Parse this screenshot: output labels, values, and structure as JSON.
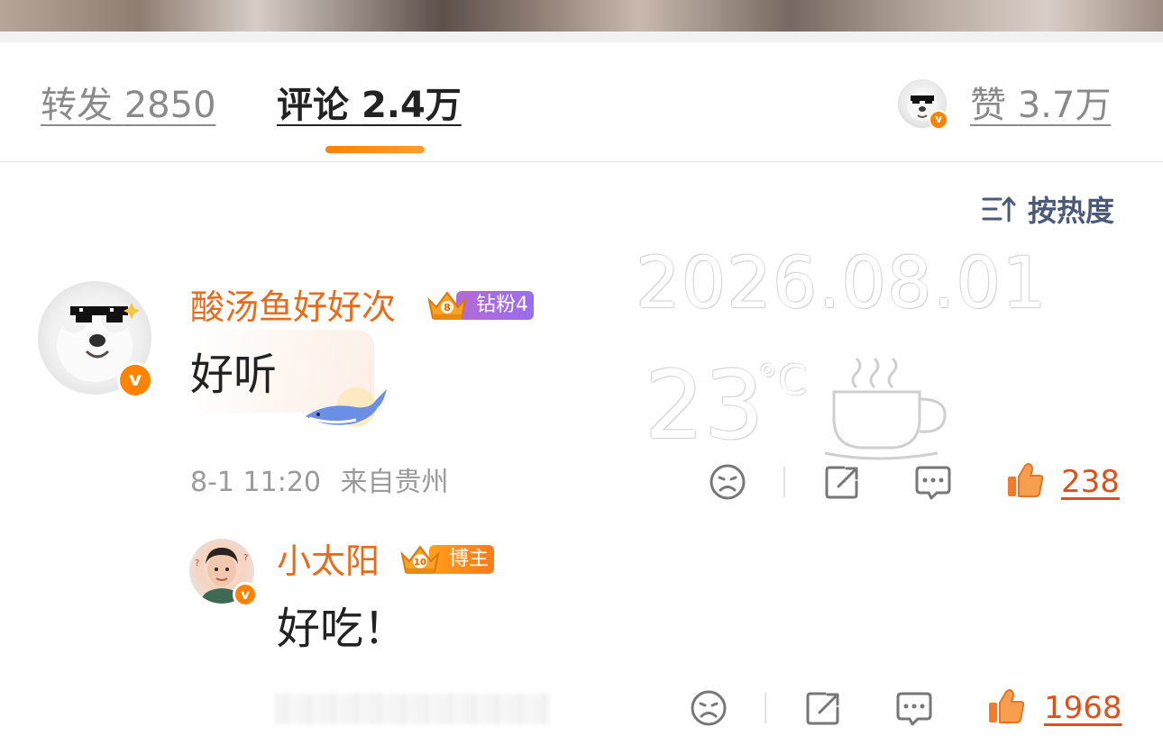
{
  "tabs": {
    "repost": {
      "label": "转发",
      "count": "2850"
    },
    "comments": {
      "label": "评论",
      "count": "2.4万"
    },
    "likes": {
      "label": "赞",
      "count": "3.7万"
    }
  },
  "sort": {
    "label": "按热度"
  },
  "watermark": {
    "date": "2026.08.01",
    "temperature": "23",
    "unit": "°C"
  },
  "colors": {
    "accent": "#ff8200",
    "username": "#e86b1a",
    "like": "#d9531e",
    "sort": "#4a5a78"
  },
  "comments": [
    {
      "username": "酸汤鱼好好次",
      "badge": {
        "level": "8",
        "label": "钻粉4"
      },
      "text": "好听",
      "time": "8-1 11:20",
      "location": "来自贵州",
      "likes": "238"
    },
    {
      "username": "小太阳",
      "badge": {
        "level": "10",
        "label": "博主"
      },
      "text": "好吃！",
      "likes": "1968"
    }
  ],
  "verify_mark": "v",
  "icons": [
    "sort-icon",
    "dislike-icon",
    "share-icon",
    "reply-icon",
    "thumbs-up-icon",
    "whale-icon",
    "coffee-cup-icon"
  ]
}
